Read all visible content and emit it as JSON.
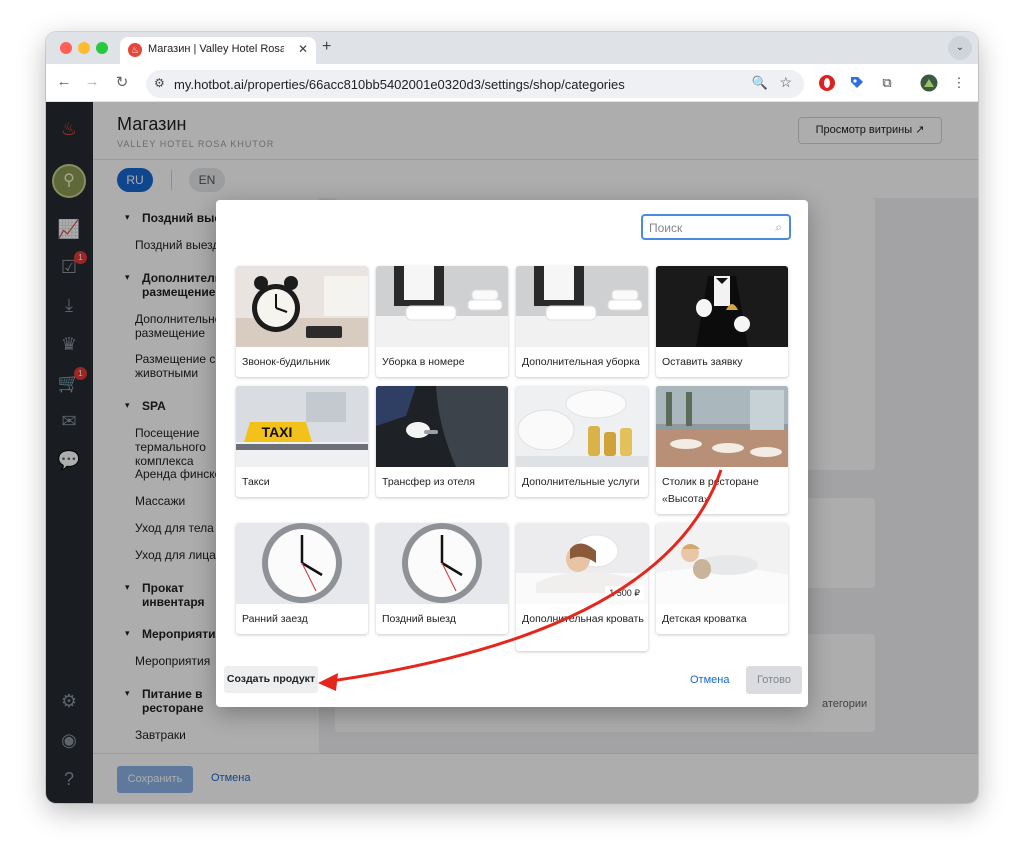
{
  "browser": {
    "tab_title": "Магазин | Valley Hotel Rosa Khutor",
    "tab_favicon": "hotbot-flame-icon",
    "new_tab_label": "+",
    "url": "my.hotbot.ai/properties/66acc810bb5402001e0320d3/settings/shop/categories"
  },
  "header": {
    "title": "Магазин",
    "subtitle": "VALLEY HOTEL ROSA KHUTOR",
    "preview_button": "Просмотр витрины ↗"
  },
  "languages": {
    "ru": "RU",
    "en": "EN"
  },
  "sidebar": {
    "badges": {
      "tasks": "1",
      "cart": "1"
    }
  },
  "categories": {
    "late_checkout_group": "Поздний выезд",
    "late_checkout_item": "Поздний выезд",
    "extra_accommodation_group": "Дополнительное размещение",
    "extra_accommodation_item": "Дополнительное размещение",
    "pets_item": "Размещение с животными",
    "spa_group": "SPA",
    "spa_terms": "Посещение термального комплекса",
    "spa_sauna": "Аренда финской сауны",
    "spa_massage": "Массажи",
    "spa_body": "Уход для тела",
    "spa_face": "Уход для лица",
    "rental_group": "Прокат инвентаря",
    "events_group": "Мероприятия",
    "events_item": "Мероприятия",
    "food_group": "Питание в ресторане",
    "food_item": "Завтраки"
  },
  "content": {
    "category_hint": "атегории"
  },
  "bottombar": {
    "save": "Сохранить",
    "cancel": "Отмена"
  },
  "modal": {
    "search_placeholder": "Поиск",
    "create_product": "Создать продукт",
    "cancel": "Отмена",
    "done": "Готово",
    "products": [
      {
        "label": "Звонок-будильник"
      },
      {
        "label": "Уборка в номере"
      },
      {
        "label": "Дополнительная уборка"
      },
      {
        "label": "Оставить заявку"
      },
      {
        "label": "Такси",
        "sign": "TAXI"
      },
      {
        "label": "Трансфер из отеля"
      },
      {
        "label": "Дополнительные услуги"
      },
      {
        "label": "Столик в ресторане «Высота»"
      },
      {
        "label": "Ранний заезд"
      },
      {
        "label": "Поздний выезд"
      },
      {
        "label": "Дополнительная кровать",
        "price": "1 500 ₽"
      },
      {
        "label": "Детская кроватка"
      }
    ]
  },
  "colors": {
    "accent": "#1967d2",
    "sidebar": "#262c33",
    "annotation_arrow": "#e5261c"
  }
}
